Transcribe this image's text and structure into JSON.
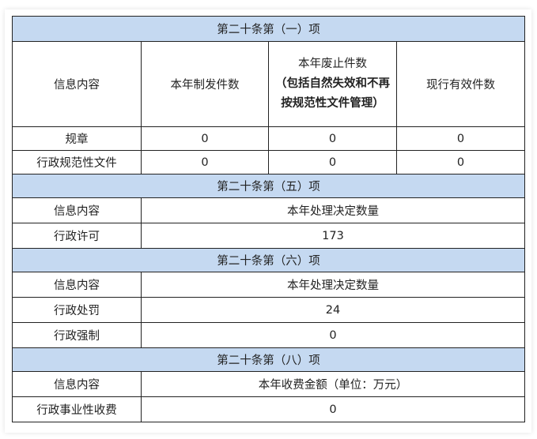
{
  "sections": [
    {
      "title": "第二十条第（一）项",
      "headers": [
        "信息内容",
        "本年制发件数",
        "本年废止件数",
        "（包括自然失效和不再按规范性文件管理）",
        "现行有效件数"
      ],
      "rows": [
        {
          "label": "规章",
          "values": [
            "0",
            "0",
            "0"
          ]
        },
        {
          "label": "行政规范性文件",
          "values": [
            "0",
            "0",
            "0"
          ]
        }
      ]
    },
    {
      "title": "第二十条第（五）项",
      "header_label": "信息内容",
      "header_value": "本年处理决定数量",
      "rows": [
        {
          "label": "行政许可",
          "value": "173"
        }
      ]
    },
    {
      "title": "第二十条第（六）项",
      "header_label": "信息内容",
      "header_value": "本年处理决定数量",
      "rows": [
        {
          "label": "行政处罚",
          "value": "24"
        },
        {
          "label": "行政强制",
          "value": "0"
        }
      ]
    },
    {
      "title": "第二十条第（八）项",
      "header_label": "信息内容",
      "header_value": "本年收费金额（单位：万元）",
      "rows": [
        {
          "label": "行政事业性收费",
          "value": "0"
        }
      ]
    }
  ]
}
